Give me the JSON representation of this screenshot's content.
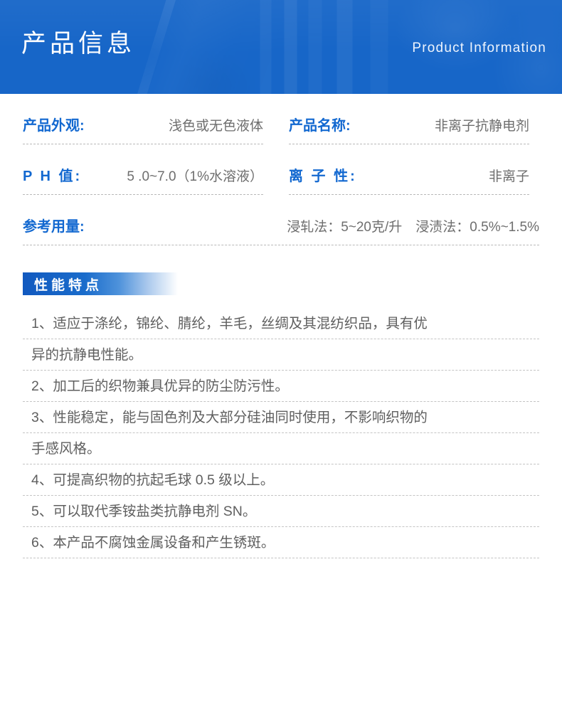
{
  "banner": {
    "title": "产品信息",
    "subtitle": "Product Information",
    "background_color": "#1766c8",
    "title_color": "#ffffff"
  },
  "specs": {
    "label_color": "#1268d0",
    "value_color": "#6e6e6e",
    "rows": [
      {
        "label": "产品外观:",
        "value": "浅色或无色液体",
        "spaced": false,
        "full": false
      },
      {
        "label": "产品名称:",
        "value": "非离子抗静电剂",
        "spaced": false,
        "full": false
      },
      {
        "label": "P H 值:",
        "value": "5 .0~7.0（1%水溶液）",
        "spaced": true,
        "full": false
      },
      {
        "label": "离 子 性:",
        "value": "非离子",
        "spaced": true,
        "full": false
      },
      {
        "label": "参考用量:",
        "value": "浸轧法：5~20克/升　浸渍法：0.5%~1.5%",
        "spaced": false,
        "full": true
      }
    ]
  },
  "section": {
    "title": "性能特点",
    "accent_color": "#1159bf"
  },
  "features": {
    "lines": [
      "1、适应于涤纶，锦纶、腈纶，羊毛，丝绸及其混纺织品，具有优",
      "异的抗静电性能。",
      "2、加工后的织物兼具优异的防尘防污性。",
      "3、性能稳定，能与固色剂及大部分硅油同时使用，不影响织物的",
      "手感风格。",
      "4、可提高织物的抗起毛球 0.5 级以上。",
      "5、可以取代季铵盐类抗静电剂 SN。",
      "6、本产品不腐蚀金属设备和产生锈斑。"
    ]
  }
}
